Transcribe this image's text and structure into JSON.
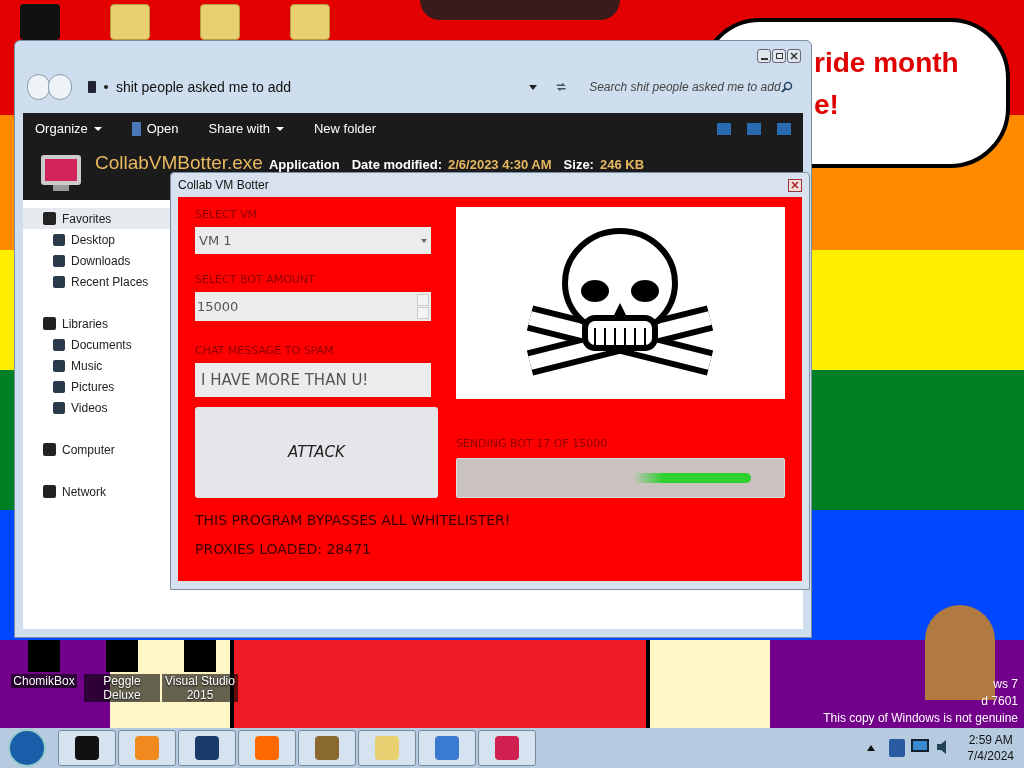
{
  "desktop": {
    "bubble_lines": [
      "ride month",
      "e!"
    ],
    "icons": [
      {
        "label": "ChomikBox"
      },
      {
        "label": "Peggle Deluxe"
      },
      {
        "label": "Visual Studio 2015"
      }
    ],
    "genuine_notice": [
      "ws 7",
      "d 7601",
      "This copy of Windows is not genuine"
    ]
  },
  "explorer": {
    "address": "shit people asked me to add",
    "search": {
      "placeholder": "Search shit people asked me to add"
    },
    "toolbar": [
      {
        "label": "Organize",
        "dropdown": true
      },
      {
        "label": "Open",
        "dropdown": false
      },
      {
        "label": "Share with",
        "dropdown": true
      },
      {
        "label": "New folder",
        "dropdown": false
      }
    ],
    "details": {
      "name": "CollabVMBotter.exe",
      "type": "Application",
      "fields": [
        {
          "label": "Date modified:",
          "value": "2/6/2023 4:30 AM"
        },
        {
          "label": "Size:",
          "value": "246 KB"
        }
      ]
    },
    "nav": [
      {
        "label": "Favorites",
        "selected": true,
        "children": [
          {
            "label": "Desktop",
            "selected": false
          },
          {
            "label": "Downloads",
            "selected": false
          },
          {
            "label": "Recent Places",
            "selected": false
          }
        ]
      },
      {
        "label": "Libraries",
        "selected": false,
        "children": [
          {
            "label": "Documents",
            "selected": false
          },
          {
            "label": "Music",
            "selected": false
          },
          {
            "label": "Pictures",
            "selected": false
          },
          {
            "label": "Videos",
            "selected": false
          }
        ]
      },
      {
        "label": "Computer",
        "selected": false
      },
      {
        "label": "Network",
        "selected": false
      }
    ]
  },
  "botter": {
    "title": "Collab VM Botter",
    "vm": {
      "label": "SELECT VM",
      "value": "VM 1"
    },
    "bots": {
      "label": "SELECT BOT AMOUNT",
      "value": "15000"
    },
    "message": {
      "label": "CHAT MESSAGE TO SPAM",
      "value": "I HAVE MORE THAN U!"
    },
    "attack_button": "ATTACK",
    "progress_label": "SENDING BOT 17 OF 15000",
    "progress": {
      "level": 0.9
    },
    "notes": [
      "THIS PROGRAM BYPASSES ALL WHITELISTER!",
      "PROXIES LOADED: 28471"
    ]
  },
  "taskbar": {
    "time": "2:59 AM",
    "date": "7/4/2024"
  }
}
